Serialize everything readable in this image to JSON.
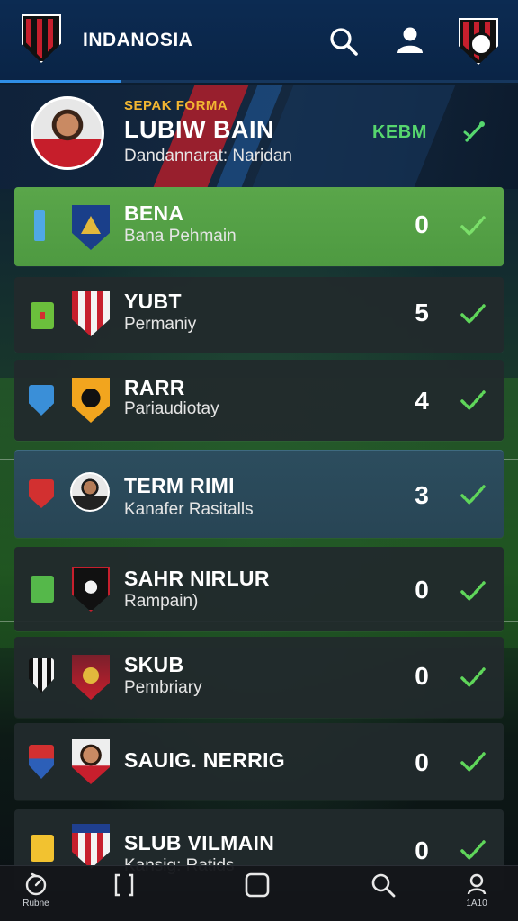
{
  "header": {
    "title": "INDANOSIA",
    "search_icon": "search-icon",
    "user_icon": "user-icon"
  },
  "profile": {
    "kicker": "SEPAK FORMA",
    "name": "LUBIW BAIN",
    "subtitle": "Dandannarat: Naridan",
    "team_tag": "KEBM",
    "edit_icon": "pencil-icon"
  },
  "rows": [
    {
      "title": "BENA",
      "subtitle": "Bana Pehmain",
      "score": "0",
      "status_color": "#4fa8e6"
    },
    {
      "title": "YUBT",
      "subtitle": "Permaniy",
      "score": "5",
      "status_color": "#6bbf3c"
    },
    {
      "title": "RARR",
      "subtitle": "Pariaudiotay",
      "score": "4",
      "status_color": "#3a8fd8"
    },
    {
      "title": "TERM RIMI",
      "subtitle": "Kanafer Rasitalls",
      "score": "3",
      "status_color": "#d23030"
    },
    {
      "title": "SAHR NIRLUR",
      "subtitle": "Rampain)",
      "score": "0",
      "status_color": "#55b84a"
    },
    {
      "title": "SKUB",
      "subtitle": "Pembriary",
      "score": "0",
      "status_color": "#d23030"
    },
    {
      "title": "SAUIG. NERRIG",
      "subtitle": "",
      "score": "0",
      "status_color": "#d23030"
    },
    {
      "title": "SLUB VILMAIN",
      "subtitle": "Kansig: Ratids",
      "score": "0",
      "status_color": "#f2c230"
    }
  ],
  "colors": {
    "accent_green": "#56d66e",
    "highlight_row": "#5aa64a",
    "selected_row": "#2c4d5e",
    "brand_red": "#c71f2d",
    "header_blue": "#0c2b52"
  },
  "nav": {
    "items": [
      {
        "label": "Rubne",
        "icon": "timer-icon"
      },
      {
        "label": "",
        "icon": "bracket-icon"
      },
      {
        "label": "",
        "icon": "square-icon"
      },
      {
        "label": "",
        "icon": "search-icon"
      },
      {
        "label": "1A10",
        "icon": "profile-icon"
      }
    ]
  }
}
